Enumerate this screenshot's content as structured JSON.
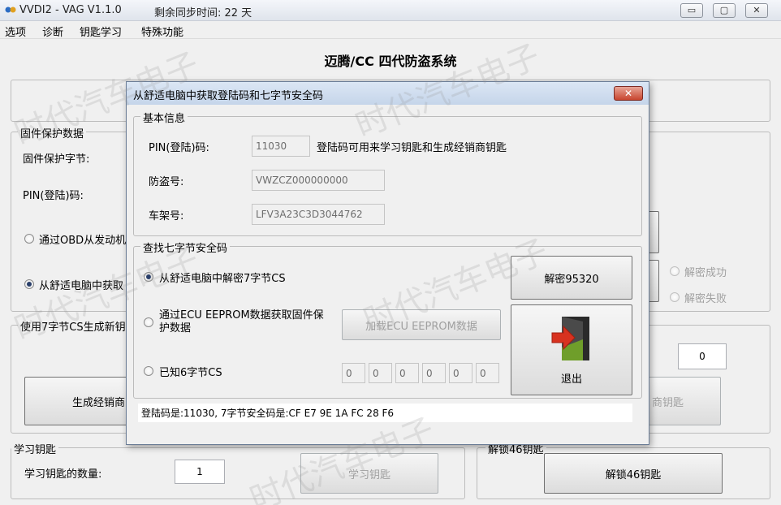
{
  "window": {
    "title": "VVDI2 - VAG V1.1.0",
    "sync": "剩余同步时间: 22 天"
  },
  "menu": [
    "选项",
    "诊断",
    "钥匙学习",
    "特殊功能"
  ],
  "main": {
    "title": "迈腾/CC 四代防盗系统",
    "firmware_group": "固件保护数据",
    "firmware_bytes_label": "固件保护字节:",
    "pin_label": "PIN(登陆)码:",
    "radio_obd": "通过OBD从发动机",
    "radio_comfort": "从舒适电脑中获取",
    "cs_group": "使用7字节CS生成新钥匙",
    "gen_dealer_key": "生成经销商",
    "dealer_key_right": "商钥匙",
    "decrypt_success": "解密成功",
    "decrypt_fail": "解密失败",
    "count_value": "0",
    "learn_group": "学习钥匙",
    "learn_count_label": "学习钥匙的数量:",
    "learn_count_value": "1",
    "learn_button": "学习钥匙",
    "unlock_group": "解锁46钥匙",
    "unlock_button": "解锁46钥匙"
  },
  "dialog": {
    "title": "从舒适电脑中获取登陆码和七字节安全码",
    "close": "✕",
    "basic_group": "基本信息",
    "pin_label": "PIN(登陆)码:",
    "pin_value": "11030",
    "pin_hint": "登陆码可用来学习钥匙和生成经销商钥匙",
    "immo_label": "防盗号:",
    "immo_value": "VWZCZ000000000",
    "vin_label": "车架号:",
    "vin_value": "LFV3A23C3D3044762",
    "cs_group": "查找七字节安全码",
    "opt_comfort": "从舒适电脑中解密7字节CS",
    "opt_eeprom": "通过ECU EEPROM数据获取固件保护数据",
    "load_eeprom": "加载ECU EEPROM数据",
    "opt_known": "已知6字节CS",
    "cs_bytes": [
      "0",
      "0",
      "0",
      "0",
      "0",
      "0"
    ],
    "decrypt_button": "解密95320",
    "exit_label": "退出",
    "status": "登陆码是:11030, 7字节安全码是:CF E7 9E 1A FC 28 F6"
  },
  "watermark": "时代汽车电子"
}
